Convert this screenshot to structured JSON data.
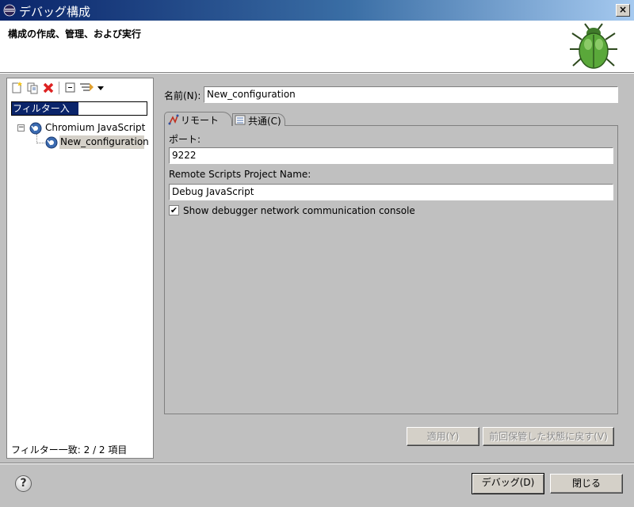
{
  "window": {
    "title": "デバッグ構成",
    "close_glyph": "×",
    "subtitle": "構成の作成、管理、および実行"
  },
  "left_panel": {
    "filter_placeholder": "フィルター入力",
    "tree": [
      {
        "label": "Chromium JavaScript",
        "expanded": true,
        "children": [
          {
            "label": "New_configuration",
            "selected": true
          }
        ]
      }
    ],
    "toggle_glyph": "−",
    "filter_status": "フィルター一致: 2 / 2 項目",
    "toolbar_icons": [
      "new-config-icon",
      "duplicate-icon",
      "delete-icon",
      "collapse-all-icon",
      "filter-icon",
      "dropdown-arrow-icon"
    ]
  },
  "editor": {
    "name_label": "名前(N):",
    "name_value": "New_configuration",
    "tabs": [
      {
        "label": "リモート",
        "icon": "remote-icon",
        "active": true
      },
      {
        "label": "共通(C)",
        "icon": "common-icon",
        "active": false
      }
    ],
    "port_label": "ポート:",
    "port_value": "9222",
    "project_label": "Remote Scripts Project Name:",
    "project_value": "Debug JavaScript",
    "console_checkbox_label": "Show debugger network communication console",
    "console_checked": true,
    "check_glyph": "✔"
  },
  "buttons": {
    "apply": "適用(Y)",
    "revert": "前回保管した状態に戻す(V)",
    "debug": "デバッグ(D)",
    "close": "閉じる",
    "help_glyph": "?"
  }
}
